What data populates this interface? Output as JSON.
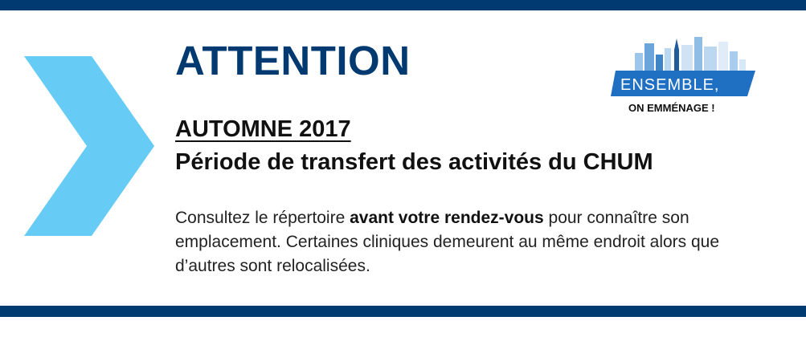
{
  "headline": "ATTENTION",
  "subheading": "AUTOMNE 2017",
  "subtitle": "Période de transfert des activités du CHUM",
  "body": {
    "part1": "Consultez le répertoire ",
    "bold": "avant votre rendez-vous",
    "part2": " pour connaître son emplacement. Certaines cliniques demeurent au même endroit alors que d’autres sont relocalisées."
  },
  "logo": {
    "main": "ENSEMBLE,",
    "sub": "ON EMMÉNAGE !"
  },
  "colors": {
    "navy": "#003a70",
    "chevron": "#66ccf5",
    "logo_band": "#1f6fc2"
  }
}
